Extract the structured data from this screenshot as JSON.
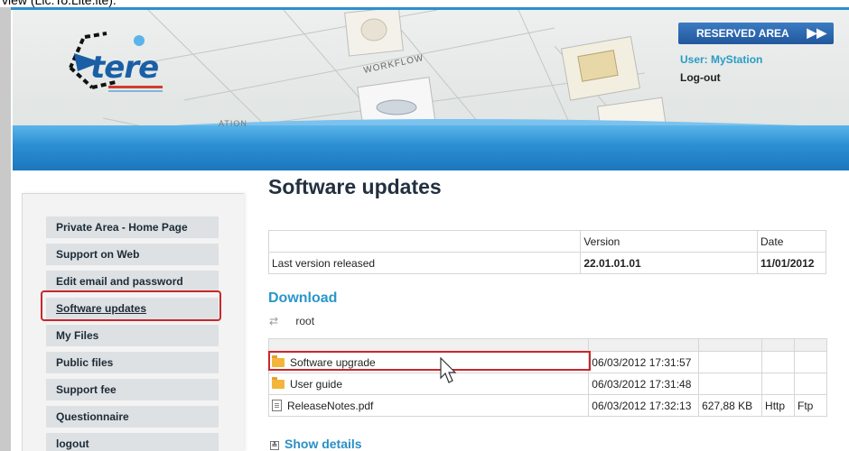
{
  "topbar": {
    "clipped_text": "view (Lic.To.Lite.ite)."
  },
  "header": {
    "logo_text": "tere",
    "sketch_label_workflow": "WORKFLOW",
    "sketch_label_ation": "ATION",
    "reserved_area_label": "RESERVED AREA",
    "reserved_area_arrow": "▶▶",
    "user_label": "User: MyStation",
    "logout_label": "Log-out"
  },
  "sidebar": {
    "items": [
      {
        "label": "Private Area - Home Page"
      },
      {
        "label": "Support on Web"
      },
      {
        "label": "Edit email and password"
      },
      {
        "label": "Software updates"
      },
      {
        "label": "My Files"
      },
      {
        "label": "Public files"
      },
      {
        "label": "Support fee"
      },
      {
        "label": "Questionnaire"
      },
      {
        "label": "logout"
      }
    ],
    "active_item": "Software updates"
  },
  "main": {
    "title": "Software updates",
    "version_table": {
      "headers": [
        "",
        "Version",
        "Date"
      ],
      "rows": [
        {
          "label": "Last version released",
          "version": "22.01.01.01",
          "date": "11/01/2012"
        }
      ]
    },
    "download_heading": "Download",
    "root_label": "root",
    "files": [
      {
        "name": "Software upgrade",
        "type": "folder",
        "date": "06/03/2012 17:31:57",
        "size": "",
        "http": "",
        "ftp": ""
      },
      {
        "name": "User guide",
        "type": "folder",
        "date": "06/03/2012 17:31:48",
        "size": "",
        "http": "",
        "ftp": ""
      },
      {
        "name": "ReleaseNotes.pdf",
        "type": "file",
        "date": "06/03/2012 17:32:13",
        "size": "627,88 KB",
        "http": "Http",
        "ftp": "Ftp"
      }
    ],
    "show_details_label": "Show details"
  },
  "colors": {
    "accent_blue": "#2a97c9",
    "highlight_red": "#c8282b",
    "header_band": "#2b8ed3",
    "menu_bg": "#dde1e4"
  }
}
